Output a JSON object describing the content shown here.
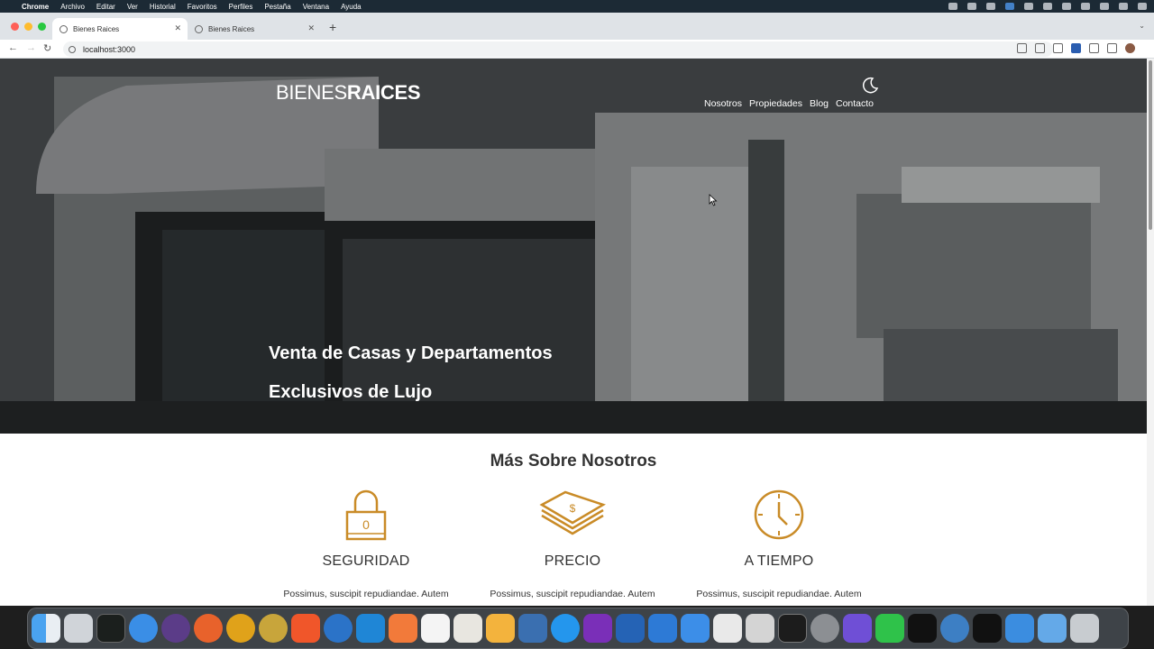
{
  "menubar": {
    "app": "Chrome",
    "items": [
      "Archivo",
      "Editar",
      "Ver",
      "Historial",
      "Favoritos",
      "Perfiles",
      "Pestaña",
      "Ventana",
      "Ayuda"
    ]
  },
  "browser": {
    "tabs": [
      {
        "title": "Bienes Raices",
        "active": true
      },
      {
        "title": "Bienes Raices",
        "active": false
      }
    ],
    "url": "localhost:3000"
  },
  "site": {
    "logo_thin": "BIENES",
    "logo_bold": "RAICES",
    "nav": [
      "Nosotros",
      "Propiedades",
      "Blog",
      "Contacto"
    ],
    "hero_line1": "Venta de Casas y Departamentos",
    "hero_line2": "Exclusivos de Lujo",
    "section_title": "Más Sobre Nosotros",
    "features": [
      {
        "icon": "lock-icon",
        "title": "SEGURIDAD",
        "text": "Possimus, suscipit repudiandae. Autem"
      },
      {
        "icon": "money-icon",
        "title": "PRECIO",
        "text": "Possimus, suscipit repudiandae. Autem"
      },
      {
        "icon": "clock-icon",
        "title": "A TIEMPO",
        "text": "Possimus, suscipit repudiandae. Autem"
      }
    ],
    "accent_color": "#c98b27"
  },
  "dock_apps": [
    "Finder",
    "Launchpad",
    "Activity Monitor",
    "Safari",
    "Notion",
    "Firefox",
    "Chrome",
    "Chrome Canary",
    "Brave",
    "Thunderbird",
    "VS Code",
    "Sublime",
    "MongoDB",
    "TablePlus",
    "Insomnia",
    "MySQL Workbench",
    "Docker",
    "Podcasts",
    "Instruments",
    "Xcode",
    "Simulator",
    "R",
    "Motion",
    "Terminal",
    "System Preferences",
    "Eyes",
    "FaceTime",
    "iD",
    "QuickTime",
    "Apple TV",
    "Keynote",
    "Downloads",
    "Trash"
  ]
}
